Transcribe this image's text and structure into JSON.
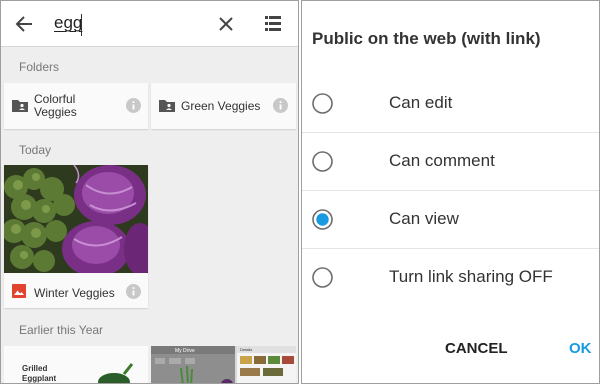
{
  "search": {
    "value": "egg"
  },
  "sections": {
    "folders": "Folders",
    "today": "Today",
    "earlier": "Earlier this Year"
  },
  "folders": [
    {
      "line1": "Colorful",
      "line2": "Veggies"
    },
    {
      "line1": "Green Veggies",
      "line2": ""
    }
  ],
  "photo": {
    "label": "Winter Veggies"
  },
  "earlier_cards": [
    {
      "line1": "Grilled",
      "line2": "Eggplant"
    },
    {
      "title": "My Drive"
    },
    {
      "title": "Details"
    }
  ],
  "dialog": {
    "title": "Public on the web (with link)",
    "options": [
      {
        "label": "Can edit",
        "selected": false
      },
      {
        "label": "Can comment",
        "selected": false
      },
      {
        "label": "Can view",
        "selected": true
      },
      {
        "label": "Turn link sharing OFF",
        "selected": false
      }
    ],
    "cancel": "CANCEL",
    "ok": "OK"
  },
  "colors": {
    "accent": "#1a9ae0",
    "photo_icon": "#e2432e",
    "icon_gray": "#444444",
    "info_gray": "#c8c8c8"
  }
}
